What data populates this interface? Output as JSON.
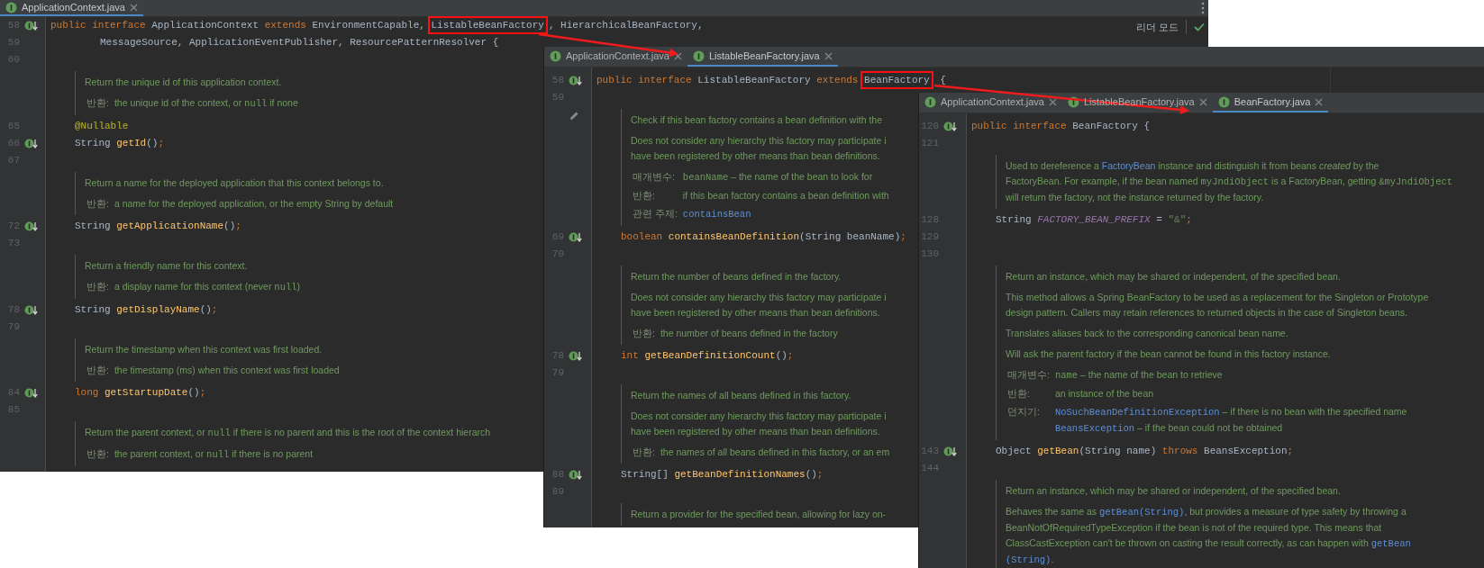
{
  "windows": [
    {
      "tabs": [
        {
          "label": "ApplicationContext.java",
          "selected": true
        }
      ],
      "header_label": "리더 모드",
      "lines": [
        {
          "kind": "declaration",
          "number": "58",
          "marker": true,
          "segments": [
            {
              "text": "public ",
              "kind": "keyword"
            },
            {
              "text": "interface ",
              "kind": "keyword"
            },
            {
              "text": "ApplicationContext "
            },
            {
              "text": "extends ",
              "kind": "keyword"
            },
            {
              "text": "EnvironmentCapable, "
            },
            {
              "text": "ListableBeanFactory",
              "highlighted": true
            },
            {
              "text": ", HierarchicalBeanFactory,"
            }
          ]
        },
        {
          "kind": "continuation",
          "number": "59",
          "segments": [
            {
              "text": "MessageSource, ApplicationEventPublisher, ResourcePatternResolver {"
            }
          ]
        },
        {
          "kind": "blank",
          "number": "60"
        },
        {
          "kind": "doc",
          "paragraphs": [
            {
              "lines": [
                [
                  {
                    "text": "Return the unique id of this application context."
                  }
                ]
              ]
            }
          ],
          "tags": [
            {
              "label": "반환:",
              "lines": [
                [
                  {
                    "text": "the unique id of the context, or "
                  },
                  {
                    "text": "null",
                    "kind": "code"
                  },
                  {
                    "text": " if none"
                  }
                ]
              ]
            }
          ]
        },
        {
          "kind": "member",
          "number": "65",
          "segments": [
            {
              "text": "@Nullable",
              "kind": "annotation"
            }
          ]
        },
        {
          "kind": "member",
          "number": "66",
          "marker": true,
          "segments": [
            {
              "text": "String "
            },
            {
              "text": "getId",
              "kind": "method"
            },
            {
              "text": "()"
            },
            {
              "text": ";",
              "kind": "semicolon"
            }
          ]
        },
        {
          "kind": "blank",
          "number": "67"
        },
        {
          "kind": "doc",
          "paragraphs": [
            {
              "lines": [
                [
                  {
                    "text": "Return a name for the deployed application that this context belongs to."
                  }
                ]
              ]
            }
          ],
          "tags": [
            {
              "label": "반환:",
              "lines": [
                [
                  {
                    "text": "a name for the deployed application, or the empty String by default"
                  }
                ]
              ]
            }
          ]
        },
        {
          "kind": "member",
          "number": "72",
          "marker": true,
          "segments": [
            {
              "text": "String "
            },
            {
              "text": "getApplicationName",
              "kind": "method"
            },
            {
              "text": "()"
            },
            {
              "text": ";",
              "kind": "semicolon"
            }
          ]
        },
        {
          "kind": "blank",
          "number": "73"
        },
        {
          "kind": "doc",
          "paragraphs": [
            {
              "lines": [
                [
                  {
                    "text": "Return a friendly name for this context."
                  }
                ]
              ]
            }
          ],
          "tags": [
            {
              "label": "반환:",
              "lines": [
                [
                  {
                    "text": "a display name for this context (never "
                  },
                  {
                    "text": "null",
                    "kind": "code"
                  },
                  {
                    "text": ")"
                  }
                ]
              ]
            }
          ]
        },
        {
          "kind": "member",
          "number": "78",
          "marker": true,
          "segments": [
            {
              "text": "String "
            },
            {
              "text": "getDisplayName",
              "kind": "method"
            },
            {
              "text": "()"
            },
            {
              "text": ";",
              "kind": "semicolon"
            }
          ]
        },
        {
          "kind": "blank",
          "number": "79"
        },
        {
          "kind": "doc",
          "paragraphs": [
            {
              "lines": [
                [
                  {
                    "text": "Return the timestamp when this context was first loaded."
                  }
                ]
              ]
            }
          ],
          "tags": [
            {
              "label": "반환:",
              "lines": [
                [
                  {
                    "text": "the timestamp (ms) when this context was first loaded"
                  }
                ]
              ]
            }
          ]
        },
        {
          "kind": "member",
          "number": "84",
          "marker": true,
          "segments": [
            {
              "text": "long ",
              "kind": "keyword"
            },
            {
              "text": "getStartupDate",
              "kind": "method"
            },
            {
              "text": "()"
            },
            {
              "text": ";",
              "kind": "semicolon"
            }
          ]
        },
        {
          "kind": "blank",
          "number": "85"
        },
        {
          "kind": "doc",
          "paragraphs": [
            {
              "lines": [
                [
                  {
                    "text": "Return the parent context, or "
                  },
                  {
                    "text": "null",
                    "kind": "code"
                  },
                  {
                    "text": " if there is no parent and this is the root of the context hierarch"
                  }
                ]
              ]
            }
          ],
          "tags": [
            {
              "label": "반환:",
              "lines": [
                [
                  {
                    "text": "the parent context, or "
                  },
                  {
                    "text": "null",
                    "kind": "code"
                  },
                  {
                    "text": " if there is no parent"
                  }
                ]
              ]
            }
          ]
        }
      ]
    },
    {
      "tabs": [
        {
          "label": "ApplicationContext.java",
          "selected": false
        },
        {
          "label": "ListableBeanFactory.java",
          "selected": true
        }
      ],
      "lines": [
        {
          "kind": "declaration",
          "number": "58",
          "marker": true,
          "segments": [
            {
              "text": "public ",
              "kind": "keyword"
            },
            {
              "text": "interface ",
              "kind": "keyword"
            },
            {
              "text": "ListableBeanFactory "
            },
            {
              "text": "extends ",
              "kind": "keyword"
            },
            {
              "text": "BeanFactory",
              "highlighted": true
            },
            {
              "text": " {"
            }
          ]
        },
        {
          "kind": "blank",
          "number": "59"
        },
        {
          "kind": "doc",
          "edit_icon": true,
          "paragraphs": [
            {
              "lines": [
                [
                  {
                    "text": "Check if this bean factory contains a bean definition with the"
                  }
                ]
              ]
            },
            {
              "lines": [
                [
                  {
                    "text": "Does not consider any hierarchy this factory may participate i"
                  }
                ],
                [
                  {
                    "text": "have been registered by other means than bean definitions."
                  }
                ]
              ]
            }
          ],
          "tags": [
            {
              "label": "매개변수:",
              "lines": [
                [
                  {
                    "text": "beanName",
                    "kind": "code"
                  },
                  {
                    "text": " – the name of the bean to look for"
                  }
                ]
              ]
            },
            {
              "label": "반환:",
              "lines": [
                [
                  {
                    "text": "if this bean factory contains a bean definition with"
                  }
                ]
              ]
            },
            {
              "label": "관련 주제:",
              "lines": [
                [
                  {
                    "text": "containsBean",
                    "kind": "code-link"
                  }
                ]
              ]
            }
          ]
        },
        {
          "kind": "member",
          "number": "69",
          "marker": true,
          "segments": [
            {
              "text": "boolean ",
              "kind": "keyword"
            },
            {
              "text": "containsBeanDefinition",
              "kind": "method"
            },
            {
              "text": "(String beanName)"
            },
            {
              "text": ";",
              "kind": "semicolon"
            }
          ]
        },
        {
          "kind": "blank",
          "number": "70"
        },
        {
          "kind": "doc",
          "paragraphs": [
            {
              "lines": [
                [
                  {
                    "text": "Return the number of beans defined in the factory."
                  }
                ]
              ]
            },
            {
              "lines": [
                [
                  {
                    "text": "Does not consider any hierarchy this factory may participate i"
                  }
                ],
                [
                  {
                    "text": "have been registered by other means than bean definitions."
                  }
                ]
              ]
            }
          ],
          "tags": [
            {
              "label": "반환:",
              "lines": [
                [
                  {
                    "text": "the number of beans defined in the factory"
                  }
                ]
              ]
            }
          ]
        },
        {
          "kind": "member",
          "number": "78",
          "marker": true,
          "segments": [
            {
              "text": "int ",
              "kind": "keyword"
            },
            {
              "text": "getBeanDefinitionCount",
              "kind": "method"
            },
            {
              "text": "()"
            },
            {
              "text": ";",
              "kind": "semicolon"
            }
          ]
        },
        {
          "kind": "blank",
          "number": "79"
        },
        {
          "kind": "doc",
          "paragraphs": [
            {
              "lines": [
                [
                  {
                    "text": "Return the names of all beans defined in this factory."
                  }
                ]
              ]
            },
            {
              "lines": [
                [
                  {
                    "text": "Does not consider any hierarchy this factory may participate i"
                  }
                ],
                [
                  {
                    "text": "have been registered by other means than bean definitions."
                  }
                ]
              ]
            }
          ],
          "tags": [
            {
              "label": "반환:",
              "lines": [
                [
                  {
                    "text": "the names of all beans defined in this factory, or an em"
                  }
                ]
              ]
            }
          ]
        },
        {
          "kind": "member",
          "number": "88",
          "marker": true,
          "segments": [
            {
              "text": "String[] "
            },
            {
              "text": "getBeanDefinitionNames",
              "kind": "method"
            },
            {
              "text": "()"
            },
            {
              "text": ";",
              "kind": "semicolon"
            }
          ]
        },
        {
          "kind": "blank",
          "number": "89"
        },
        {
          "kind": "doc",
          "paragraphs": [
            {
              "lines": [
                [
                  {
                    "text": "Return a provider for the specified bean, allowing for lazy on-"
                  }
                ]
              ]
            }
          ]
        }
      ]
    },
    {
      "tabs": [
        {
          "label": "ApplicationContext.java",
          "selected": false
        },
        {
          "label": "ListableBeanFactory.java",
          "selected": false
        },
        {
          "label": "BeanFactory.java",
          "selected": true
        }
      ],
      "lines": [
        {
          "kind": "declaration",
          "number": "120",
          "marker": true,
          "segments": [
            {
              "text": "public ",
              "kind": "keyword"
            },
            {
              "text": "interface ",
              "kind": "keyword"
            },
            {
              "text": "BeanFactory {"
            }
          ]
        },
        {
          "kind": "blank",
          "number": "121"
        },
        {
          "kind": "doc",
          "paragraphs": [
            {
              "lines": [
                [
                  {
                    "text": "Used to dereference a "
                  },
                  {
                    "text": "FactoryBean",
                    "kind": "link"
                  },
                  {
                    "text": " instance and distinguish it from beans "
                  },
                  {
                    "text": "created",
                    "kind": "italic"
                  },
                  {
                    "text": " by the"
                  }
                ],
                [
                  {
                    "text": "FactoryBean. For example, if the bean named "
                  },
                  {
                    "text": "myJndiObject",
                    "kind": "code"
                  },
                  {
                    "text": " is a FactoryBean, getting "
                  },
                  {
                    "text": "&myJndiObject",
                    "kind": "code"
                  }
                ],
                [
                  {
                    "text": "will return the factory, not the instance returned by the factory."
                  }
                ]
              ]
            }
          ]
        },
        {
          "kind": "member",
          "number": "128",
          "segments": [
            {
              "text": "String "
            },
            {
              "text": "FACTORY_BEAN_PREFIX",
              "kind": "constant"
            },
            {
              "text": " = "
            },
            {
              "text": "\"&\"",
              "kind": "string"
            },
            {
              "text": ";",
              "kind": "semicolon"
            }
          ]
        },
        {
          "kind": "blank",
          "number": "129"
        },
        {
          "kind": "blank",
          "number": "130"
        },
        {
          "kind": "doc",
          "paragraphs": [
            {
              "lines": [
                [
                  {
                    "text": "Return an instance, which may be shared or independent, of the specified bean."
                  }
                ]
              ]
            },
            {
              "lines": [
                [
                  {
                    "text": "This method allows a Spring BeanFactory to be used as a replacement for the Singleton or Prototype"
                  }
                ],
                [
                  {
                    "text": "design pattern. Callers may retain references to returned objects in the case of Singleton beans."
                  }
                ]
              ]
            },
            {
              "lines": [
                [
                  {
                    "text": "Translates aliases back to the corresponding canonical bean name."
                  }
                ]
              ]
            },
            {
              "lines": [
                [
                  {
                    "text": "Will ask the parent factory if the bean cannot be found in this factory instance."
                  }
                ]
              ]
            }
          ],
          "tags": [
            {
              "label": "매개변수:",
              "lines": [
                [
                  {
                    "text": "name",
                    "kind": "code"
                  },
                  {
                    "text": " – the name of the bean to retrieve"
                  }
                ]
              ]
            },
            {
              "label": "반환:",
              "lines": [
                [
                  {
                    "text": "an instance of the bean"
                  }
                ]
              ]
            },
            {
              "label": "던지기:",
              "lines": [
                [
                  {
                    "text": "NoSuchBeanDefinitionException",
                    "kind": "code-link"
                  },
                  {
                    "text": " – if there is no bean with the specified name"
                  }
                ],
                [
                  {
                    "text": "BeansException",
                    "kind": "code-link"
                  },
                  {
                    "text": " – if the bean could not be obtained"
                  }
                ]
              ]
            }
          ]
        },
        {
          "kind": "member",
          "number": "143",
          "marker": true,
          "segments": [
            {
              "text": "Object "
            },
            {
              "text": "getBean",
              "kind": "method"
            },
            {
              "text": "(String name) "
            },
            {
              "text": "throws",
              "kind": "keyword"
            },
            {
              "text": " BeansException"
            },
            {
              "text": ";",
              "kind": "semicolon"
            }
          ]
        },
        {
          "kind": "blank",
          "number": "144"
        },
        {
          "kind": "doc",
          "paragraphs": [
            {
              "lines": [
                [
                  {
                    "text": "Return an instance, which may be shared or independent, of the specified bean."
                  }
                ]
              ]
            },
            {
              "lines": [
                [
                  {
                    "text": "Behaves the same as "
                  },
                  {
                    "text": "getBean(String)",
                    "kind": "code-link"
                  },
                  {
                    "text": ", but provides a measure of type safety by throwing a"
                  }
                ],
                [
                  {
                    "text": "BeanNotOfRequiredTypeException if the bean is not of the required type. This means that"
                  }
                ],
                [
                  {
                    "text": "ClassCastException can't be thrown on casting the result correctly, as can happen with "
                  },
                  {
                    "text": "getBean",
                    "kind": "code-link"
                  }
                ],
                [
                  {
                    "text": "(String)",
                    "kind": "code-link"
                  },
                  {
                    "text": "."
                  }
                ]
              ]
            }
          ]
        }
      ]
    }
  ]
}
